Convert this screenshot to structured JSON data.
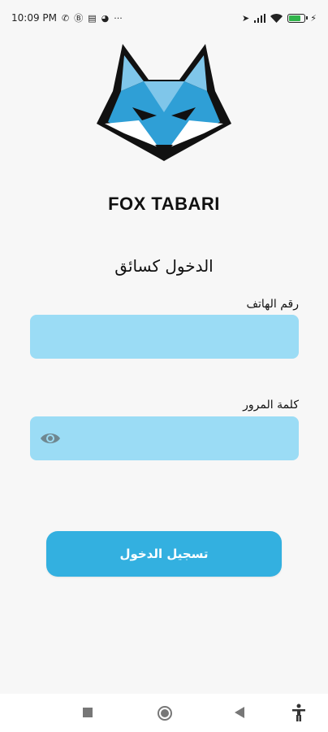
{
  "status_bar": {
    "time": "10:09 PM",
    "left_icons": [
      "whatsapp-icon",
      "whatsapp-business-icon",
      "document-icon",
      "pie-chart-icon",
      "more-icon"
    ],
    "more": "···",
    "right_icons": [
      "location-icon",
      "signal-icon",
      "wifi-icon",
      "battery-icon",
      "charging-icon"
    ],
    "battery_level": 0.85,
    "battery_color": "#31b44b"
  },
  "brand": {
    "name": "FOX TABARI",
    "logo": "fox-logo"
  },
  "form": {
    "title": "الدخول كسائق",
    "phone_label": "رقم الهاتف",
    "phone_value": "",
    "password_label": "كلمة المرور",
    "password_value": "",
    "login_button": "تسجيل الدخول"
  },
  "colors": {
    "field_bg": "#9bdcf5",
    "button_bg": "#33b0e0",
    "page_bg": "#f7f7f7"
  },
  "nav_bar": {
    "items": [
      "recents-button",
      "home-button",
      "back-button",
      "accessibility-button"
    ]
  }
}
